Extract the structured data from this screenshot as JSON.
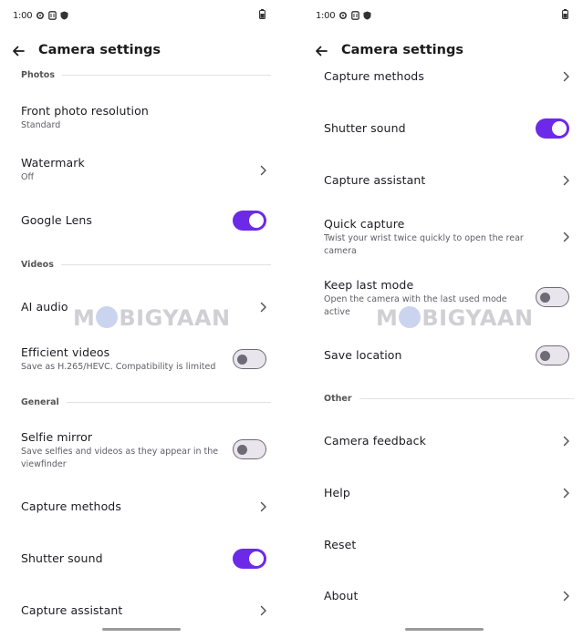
{
  "status": {
    "time": "1:00"
  },
  "appbar": {
    "title": "Camera settings"
  },
  "watermark": {
    "pre": "M",
    "post": "BIGYAAN"
  },
  "left": {
    "sections": {
      "photos": "Photos",
      "videos": "Videos",
      "general": "General"
    },
    "items": {
      "front_photo_resolution": {
        "title": "Front photo resolution",
        "subtitle": "Standard"
      },
      "watermark": {
        "title": "Watermark",
        "subtitle": "Off"
      },
      "google_lens": {
        "title": "Google Lens",
        "state": "on"
      },
      "ai_audio": {
        "title": "AI audio"
      },
      "efficient_videos": {
        "title": "Efficient videos",
        "subtitle": "Save as H.265/HEVC. Compatibility is limited",
        "state": "off"
      },
      "selfie_mirror": {
        "title": "Selfie mirror",
        "subtitle": "Save selfies and videos as they appear in the viewfinder",
        "state": "off"
      },
      "capture_methods": {
        "title": "Capture methods"
      },
      "shutter_sound": {
        "title": "Shutter sound",
        "state": "on"
      },
      "capture_assistant": {
        "title": "Capture assistant"
      }
    }
  },
  "right": {
    "sections": {
      "other": "Other"
    },
    "items": {
      "capture_methods": {
        "title": "Capture methods"
      },
      "shutter_sound": {
        "title": "Shutter sound",
        "state": "on"
      },
      "capture_assistant": {
        "title": "Capture assistant"
      },
      "quick_capture": {
        "title": "Quick capture",
        "subtitle": "Twist your wrist twice quickly to open the rear camera"
      },
      "keep_last_mode": {
        "title": "Keep last mode",
        "subtitle": "Open the camera with the last used mode active",
        "state": "off"
      },
      "save_location": {
        "title": "Save location",
        "state": "off"
      },
      "camera_feedback": {
        "title": "Camera feedback"
      },
      "help": {
        "title": "Help"
      },
      "reset": {
        "title": "Reset"
      },
      "about": {
        "title": "About"
      }
    }
  },
  "colors": {
    "accent": "#6c2ae8",
    "toggle_off_track": "#e8e6ec",
    "toggle_off_border": "#6f6b76",
    "divider": "#e2e2e2"
  },
  "icons": [
    "settings-gear-icon",
    "nfc-icon",
    "shield-icon",
    "battery-icon",
    "back-arrow-icon",
    "chevron-right-icon"
  ]
}
